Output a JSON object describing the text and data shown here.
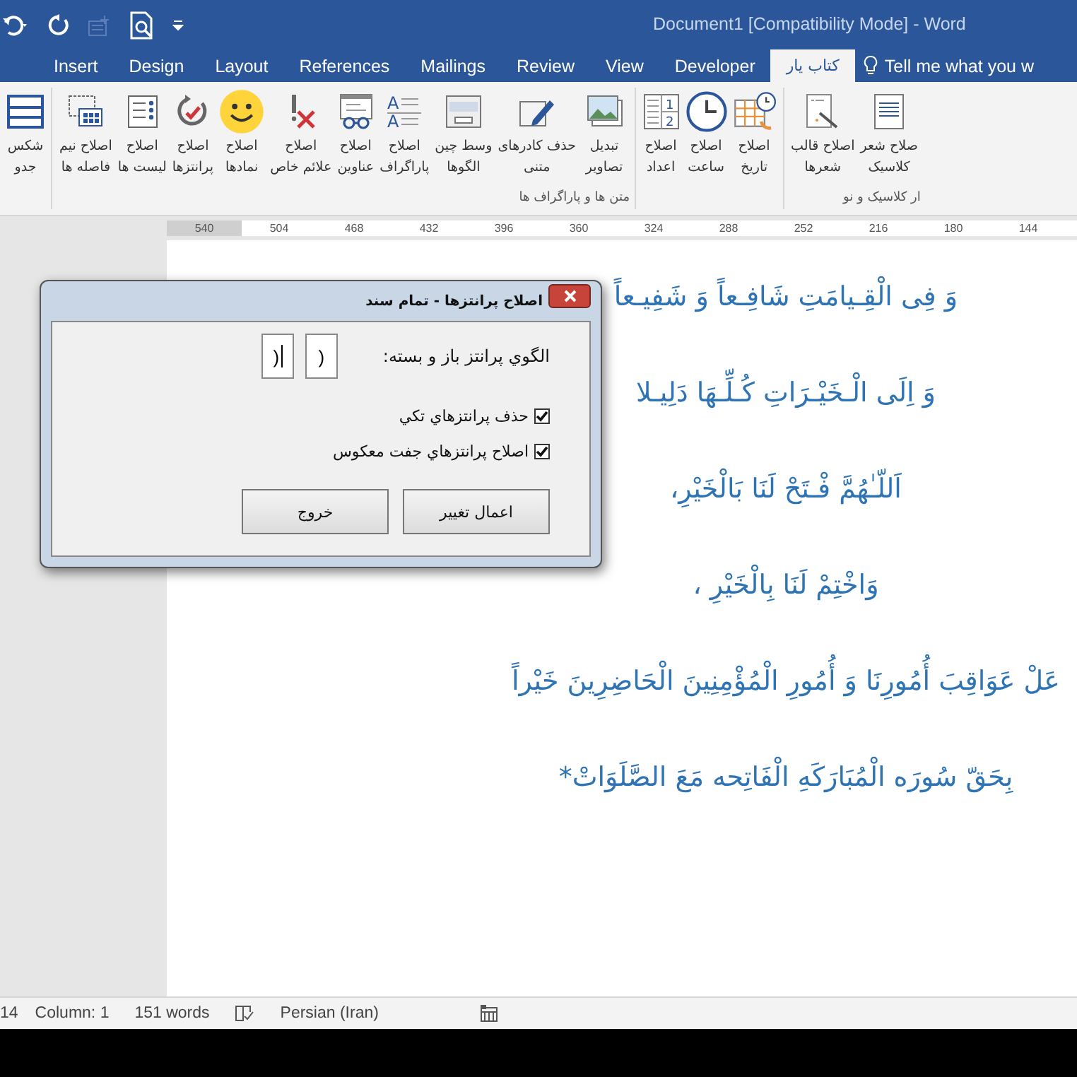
{
  "window": {
    "title": "Document1 [Compatibility Mode] - Word"
  },
  "tabs": [
    {
      "label": "کتاب یار",
      "selected": true
    },
    {
      "label": "Developer",
      "selected": false
    },
    {
      "label": "View",
      "selected": false
    },
    {
      "label": "Review",
      "selected": false
    },
    {
      "label": "Mailings",
      "selected": false
    },
    {
      "label": "References",
      "selected": false
    },
    {
      "label": "Layout",
      "selected": false
    },
    {
      "label": "Design",
      "selected": false
    },
    {
      "label": "Insert",
      "selected": false
    }
  ],
  "tell_me": "Tell me what you w",
  "ribbon": {
    "groups": [
      {
        "label": "ار کلاسیک و نو",
        "items": [
          {
            "kind": "poem",
            "lines": [
              "صلاح شعر",
              "کلاسیک"
            ]
          },
          {
            "kind": "template",
            "lines": [
              "اصلاح قالب",
              "شعرها"
            ]
          }
        ]
      },
      {
        "items": [
          {
            "kind": "calendar",
            "lines": [
              "اصلاح",
              "تاریخ"
            ]
          },
          {
            "kind": "clock",
            "lines": [
              "اصلاح",
              "ساعت"
            ]
          },
          {
            "kind": "numbers",
            "icon_labels": [
              "1",
              "2"
            ],
            "lines": [
              "اصلاح",
              "اعداد"
            ]
          }
        ]
      },
      {
        "label": "متن ها و پاراگراف ها",
        "items": [
          {
            "kind": "image",
            "lines": [
              "تبدیل",
              "تصاویر"
            ]
          },
          {
            "kind": "pencil",
            "lines": [
              "حذف کادرهای",
              "متنی"
            ]
          },
          {
            "kind": "center",
            "lines": [
              "وسط چین",
              "الگوها"
            ]
          },
          {
            "kind": "para",
            "icon_labels": [
              "A",
              "A"
            ],
            "lines": [
              "اصلاح",
              "پاراگراف"
            ]
          },
          {
            "kind": "glasses",
            "lines": [
              "اصلاح",
              "عناوین"
            ]
          },
          {
            "kind": "mark",
            "lines": [
              "اصلاح",
              "علائم خاص"
            ]
          },
          {
            "kind": "smiley",
            "lines": [
              "اصلاح",
              "نمادها"
            ]
          },
          {
            "kind": "check",
            "lines": [
              "اصلاح",
              "پرانتزها"
            ]
          },
          {
            "kind": "list",
            "lines": [
              "اصلاح",
              "لیست ها"
            ]
          },
          {
            "kind": "grid",
            "lines": [
              "اصلاح نیم",
              "فاصله ها"
            ]
          }
        ]
      },
      {
        "items": [
          {
            "kind": "table",
            "lines": [
              "شکس",
              "جدو"
            ]
          }
        ]
      }
    ]
  },
  "ruler": {
    "ticks": [
      "144",
      "180",
      "216",
      "252",
      "288",
      "324",
      "360",
      "396",
      "432",
      "468",
      "504",
      "540"
    ]
  },
  "dialog": {
    "title": "اصلاح پرانتزها - تمام سند",
    "pattern_label": "الگوي پرانتز باز و بسته:",
    "fields": [
      {
        "value": "(",
        "focused": false
      },
      {
        "value": "(",
        "focused": true
      }
    ],
    "checkboxes": [
      {
        "label": "حذف پرانتزهاي تکي",
        "checked": true
      },
      {
        "label": "اصلاح پرانتزهاي جفت معکوس",
        "checked": true
      }
    ],
    "buttons": [
      "اعمال تغییر",
      "خروج"
    ]
  },
  "document": {
    "lines": [
      "وَ فِی الْقِـیامَتِ شَافِـعاً وَ شَفِیـعاً",
      "وَ اِلَی الْـخَیْـرَاتِ کُـلِّـهَا دَلِیـلا",
      "اَللّـٰهُمَّ فْـتَحْ لَنَا بَالْخَیْرِ،",
      "وَاخْتِمْ لَنَا بِالْخَیْرِ ،",
      "عَلْ عَوَاقِبَ أُمُورِنَا وَ أُمُورِ الْمُؤْمِنِینَ الْحَاضِرِینَ خَیْراً",
      "بِحَقّ سُورَه الْمُبَارَکَهِ الْفَاتِحه مَعَ الصَّلَوَاتْ*"
    ]
  },
  "status_bar": {
    "page": "14",
    "column": "Column: 1",
    "words": "151 words",
    "language": "Persian (Iran)"
  }
}
